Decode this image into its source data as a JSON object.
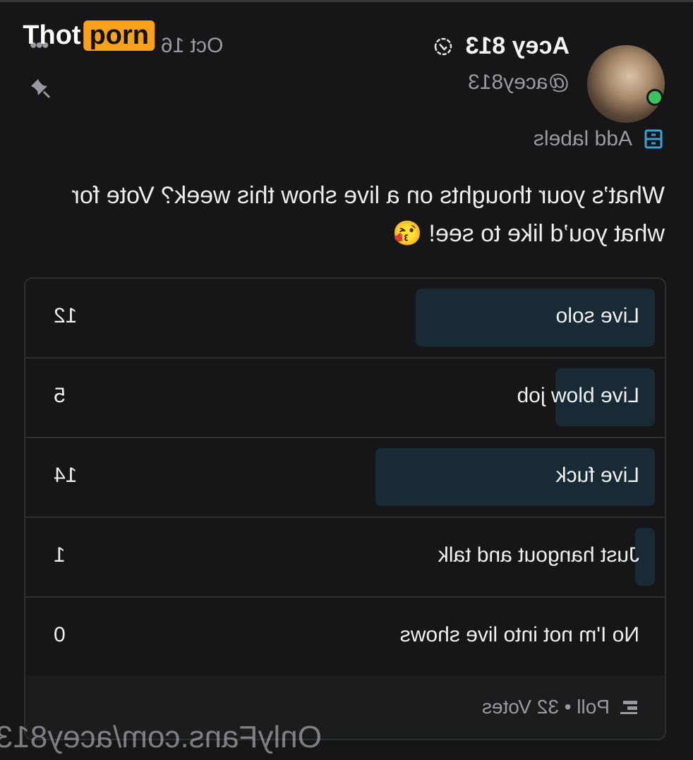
{
  "post": {
    "name": "Acey 813",
    "handle": "@acey813",
    "date": "Oct 16",
    "more": "•••",
    "labels": "Add labels",
    "text": "What’s your thoughts on a live show this week? Vote for what you’d like to see! 😘"
  },
  "poll": {
    "options": [
      {
        "label": "Live solo",
        "count": "12"
      },
      {
        "label": "Live blow job",
        "count": "5"
      },
      {
        "label": "Live fuck",
        "count": "14"
      },
      {
        "label": "Just hangout and talk",
        "count": "1"
      },
      {
        "label": "No I'm not into live shows",
        "count": "0"
      }
    ],
    "footer": "Poll • 32 Votes"
  },
  "watermark": "OnlyFans.com/acey813",
  "logo": {
    "left": "Thot",
    "right": "porn"
  },
  "colors": {
    "background": "#161618",
    "bar": "#172a35",
    "accent": "#3aa0d8",
    "online": "#3ac25c",
    "logo": "#f7a21a"
  }
}
